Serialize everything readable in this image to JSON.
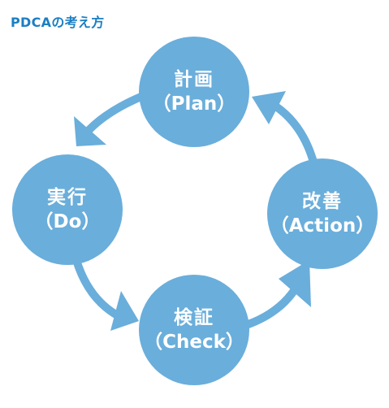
{
  "title": "PDCAの考え方",
  "colors": {
    "accent": "#1b7fc4",
    "circle": "#6aaedb",
    "arrow": "#6aaedb",
    "background": "#ffffff"
  },
  "nodes": {
    "plan": {
      "name": "計画",
      "sub": "（Plan）"
    },
    "do": {
      "name": "実行",
      "sub": "（Do）"
    },
    "check": {
      "name": "検証",
      "sub": "（Check）"
    },
    "action": {
      "name": "改善",
      "sub": "（Action）"
    }
  }
}
